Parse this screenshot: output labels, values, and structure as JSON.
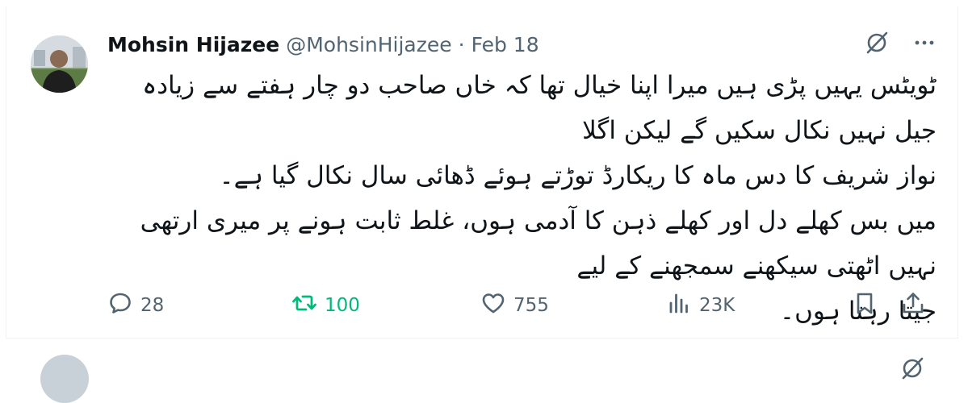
{
  "tweet": {
    "author_name": "Mohsin Hijazee",
    "handle": "@MohsinHijazee",
    "separator": "·",
    "date": "Feb 18",
    "body_lines": [
      "ٹویٹس یہیں پڑی ہیں میرا اپنا خیال تھا کہ خاں صاحب دو چار ہفتے سے زیادہ جیل نہیں نکال سکیں گے لیکن اگلا",
      "نواز شریف کا دس ماہ کا ریکارڈ توڑتے ہوئے ڈھائی سال نکال گیا ہے۔",
      "میں بس کھلے دل اور کھلے ذہن کا آدمی ہوں، غلط ثابت ہونے پر میری ارتھی نہیں اٹھتی سیکھنے سمجھنے کے لیے",
      "جیتا رہتا ہوں۔"
    ],
    "stats": {
      "replies": "28",
      "retweets": "100",
      "likes": "755",
      "views": "23K"
    },
    "colors": {
      "retweet_active": "#00ba7c",
      "muted": "#536471",
      "text": "#0f1419"
    },
    "icons": [
      "grok-icon",
      "more-icon",
      "reply-icon",
      "retweet-icon",
      "like-icon",
      "views-icon",
      "bookmark-icon",
      "share-icon"
    ]
  }
}
